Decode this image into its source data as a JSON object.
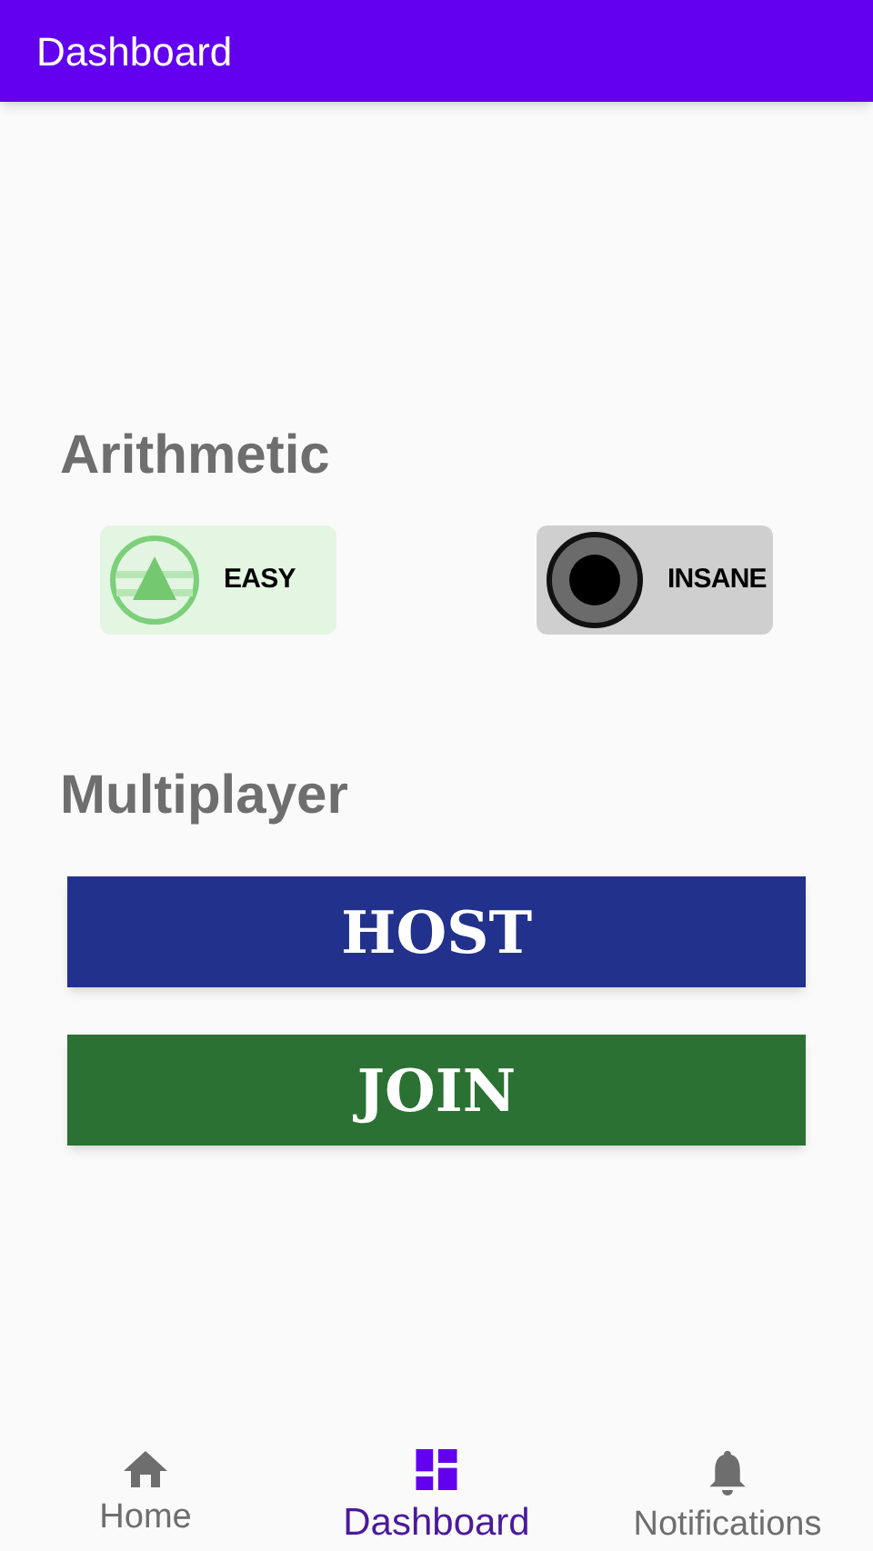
{
  "app_bar": {
    "title": "Dashboard"
  },
  "arithmetic": {
    "heading": "Arithmetic",
    "modes": [
      {
        "kind": "easy",
        "label": "EASY"
      },
      {
        "kind": "insane",
        "label": "INSANE"
      }
    ]
  },
  "multiplayer": {
    "heading": "Multiplayer",
    "buttons": [
      {
        "label": "HOST",
        "color": "#22318c"
      },
      {
        "label": "JOIN",
        "color": "#2b7133"
      }
    ]
  },
  "bottom_nav": [
    {
      "kind": "home",
      "label": "Home",
      "selected": false
    },
    {
      "kind": "dashboard",
      "label": "Dashboard",
      "selected": true
    },
    {
      "kind": "notifications",
      "label": "Notifications",
      "selected": false
    }
  ]
}
